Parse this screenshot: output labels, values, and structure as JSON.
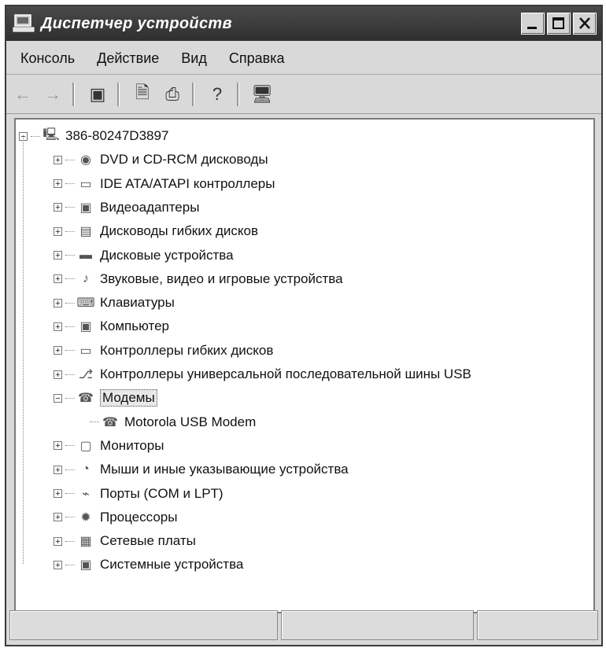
{
  "window": {
    "title": "Диспетчер устройств"
  },
  "menu": [
    "Консоль",
    "Действие",
    "Вид",
    "Справка"
  ],
  "toolbar": [
    {
      "icon": "back-arrow-icon",
      "glyph": "←",
      "dim": true
    },
    {
      "icon": "forward-arrow-icon",
      "glyph": "→",
      "dim": true
    },
    {
      "icon": "show-hide-tree-icon",
      "glyph": "▣",
      "dim": false
    },
    {
      "icon": "properties-icon",
      "glyph": "🗎",
      "dim": false
    },
    {
      "icon": "print-icon",
      "glyph": "⎙",
      "dim": false
    },
    {
      "icon": "help-icon",
      "glyph": "?",
      "dim": false
    },
    {
      "icon": "scan-hardware-icon",
      "glyph": "🖥",
      "dim": false
    }
  ],
  "tree": {
    "root": "386-80247D3897",
    "items": [
      {
        "label": "DVD и CD-RCM дисководы",
        "icon": "dvd-drive-icon",
        "glyph": "◉"
      },
      {
        "label": "IDE ATA/ATAPI контроллеры",
        "icon": "ide-controller-icon",
        "glyph": "▭"
      },
      {
        "label": "Видеоадаптеры",
        "icon": "display-adapter-icon",
        "glyph": "▣"
      },
      {
        "label": "Дисководы гибких дисков",
        "icon": "floppy-drive-icon",
        "glyph": "▤"
      },
      {
        "label": "Дисковые устройства",
        "icon": "disk-drive-icon",
        "glyph": "▬"
      },
      {
        "label": "Звуковые, видео и игровые устройства",
        "icon": "sound-icon",
        "glyph": "♪"
      },
      {
        "label": "Клавиатуры",
        "icon": "keyboard-icon",
        "glyph": "⌨"
      },
      {
        "label": "Компьютер",
        "icon": "computer-icon",
        "glyph": "▣"
      },
      {
        "label": "Контроллеры гибких дисков",
        "icon": "floppy-controller-icon",
        "glyph": "▭"
      },
      {
        "label": "Контроллеры универсальной последовательной шины USB",
        "icon": "usb-icon",
        "glyph": "⎇"
      },
      {
        "label": "Модемы",
        "icon": "modem-icon",
        "glyph": "☎",
        "expanded": true,
        "selected": true,
        "children": [
          {
            "label": "Motorola USB Modem",
            "icon": "modem-device-icon",
            "glyph": "☎"
          }
        ]
      },
      {
        "label": "Мониторы",
        "icon": "monitor-icon",
        "glyph": "▢"
      },
      {
        "label": "Мыши и иные указывающие устройства",
        "icon": "mouse-icon",
        "glyph": "◔"
      },
      {
        "label": "Порты (COM и LPT)",
        "icon": "port-icon",
        "glyph": "⌁"
      },
      {
        "label": "Процессоры",
        "icon": "processor-icon",
        "glyph": "✹"
      },
      {
        "label": "Сетевые платы",
        "icon": "network-adapter-icon",
        "glyph": "▦"
      },
      {
        "label": "Системные устройства",
        "icon": "system-device-icon",
        "glyph": "▣"
      }
    ]
  },
  "statusbar": {
    "cells": [
      "",
      "",
      ""
    ]
  }
}
